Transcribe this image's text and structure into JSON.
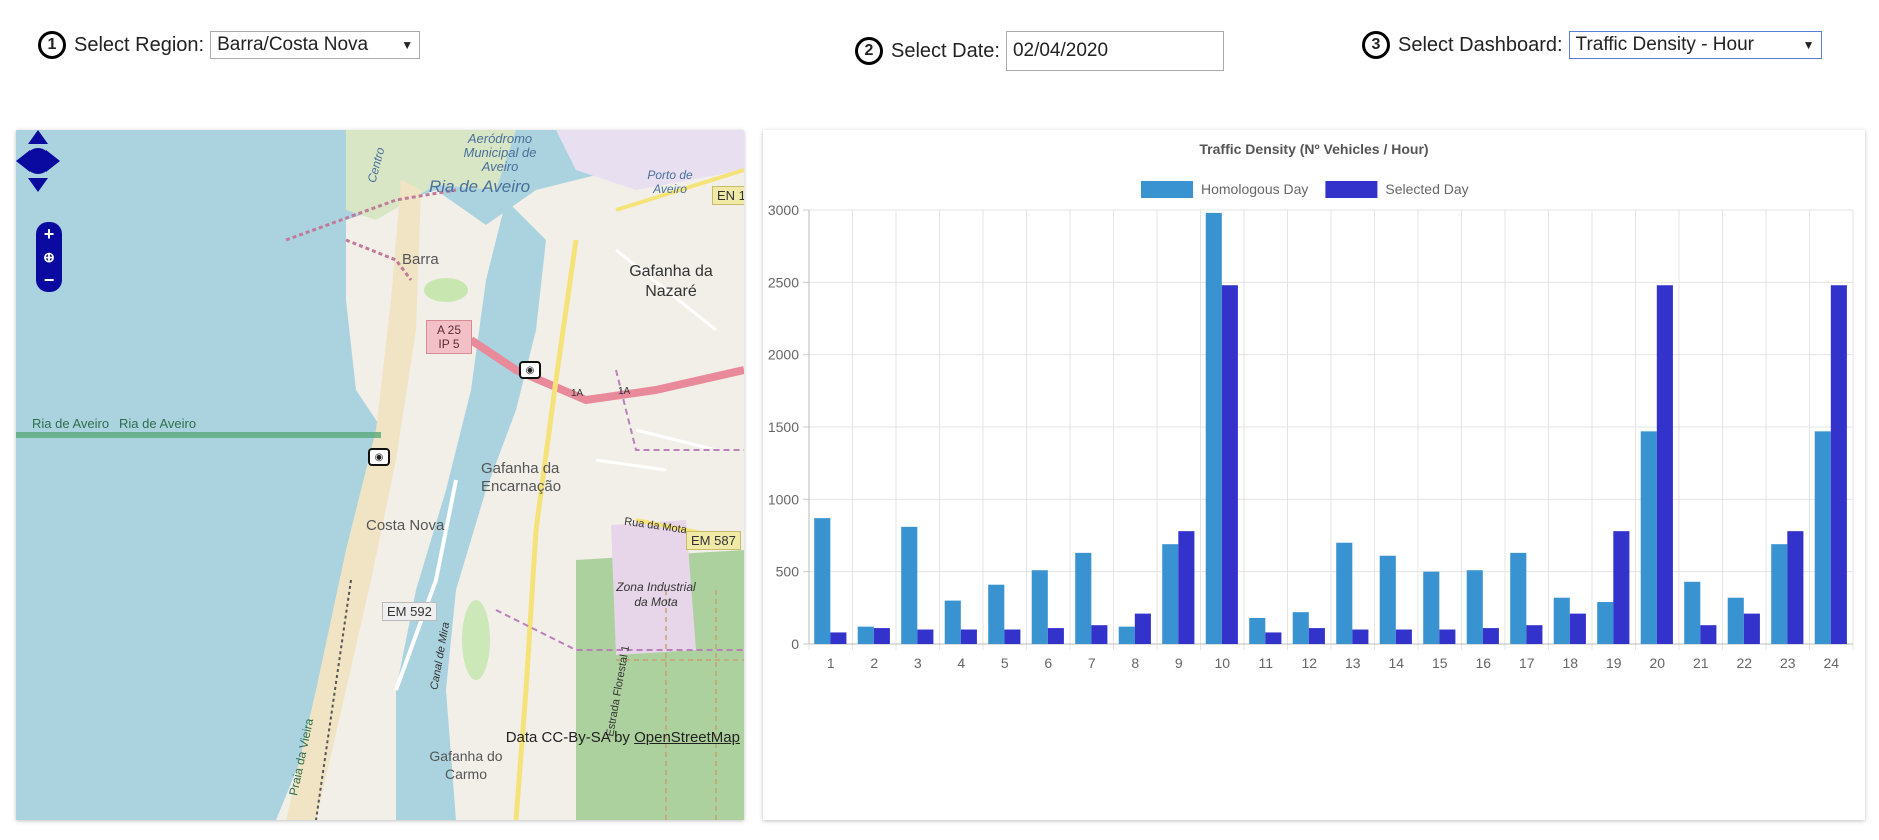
{
  "controls": {
    "step1": {
      "number": "1",
      "label": "Select Region:",
      "value": "Barra/Costa Nova"
    },
    "step2": {
      "number": "2",
      "label": "Select Date:",
      "value": "02/04/2020"
    },
    "step3": {
      "number": "3",
      "label": "Select Dashboard:",
      "value": "Traffic Density - Hour"
    }
  },
  "map": {
    "labels": {
      "aerodromo": "Aeródromo Municipal de Aveiro",
      "ria_top": "Ria de Aveiro",
      "porto": "Porto de Aveiro",
      "centro": "Centro",
      "barra": "Barra",
      "gafanha_nazare": "Gafanha da Nazaré",
      "ria_left1": "Ria de Aveiro",
      "ria_left2": "Ria de Aveiro",
      "gafanha_encarnacao": "Gafanha da Encarnação",
      "costa_nova": "Costa Nova",
      "rua_mota": "Rua da Mota",
      "zona_industrial": "Zona Industrial da Mota",
      "gafanha_carmo": "Gafanha do Carmo",
      "canal_mira": "Canal de Mira",
      "estrada_florestal": "Estrada Florestal 1",
      "praia_vieira": "Praia da Vieira",
      "a1a_1": "1A",
      "a1a_2": "1A"
    },
    "shields": {
      "en": "EN 1",
      "em587": "EM 587",
      "em592": "EM 592",
      "a25_line1": "A 25",
      "a25_line2": "IP 5"
    },
    "attribution_prefix": "Data CC-By-SA by",
    "attribution_link": "OpenStreetMap",
    "zoom_in": "+",
    "zoom_out": "−"
  },
  "chart_data": {
    "type": "bar",
    "title": "Traffic Density (Nº Vehicles / Hour)",
    "xlabel": "",
    "ylabel": "",
    "ylim": [
      0,
      3000
    ],
    "yticks": [
      0,
      500,
      1000,
      1500,
      2000,
      2500,
      3000
    ],
    "categories": [
      "1",
      "2",
      "3",
      "4",
      "5",
      "6",
      "7",
      "8",
      "9",
      "10",
      "11",
      "12",
      "13",
      "14",
      "15",
      "16",
      "17",
      "18",
      "19",
      "20",
      "21",
      "22",
      "23",
      "24"
    ],
    "series": [
      {
        "name": "Homologous Day",
        "color": "#3a93d1",
        "values": [
          870,
          120,
          810,
          300,
          410,
          510,
          630,
          120,
          690,
          2980,
          180,
          220,
          700,
          610,
          500,
          510,
          630,
          320,
          290,
          1470,
          430,
          320,
          690,
          1470
        ]
      },
      {
        "name": "Selected Day",
        "color": "#3333cc",
        "values": [
          80,
          110,
          100,
          100,
          100,
          110,
          130,
          210,
          780,
          2480,
          80,
          110,
          100,
          100,
          100,
          110,
          130,
          210,
          780,
          2480,
          130,
          210,
          780,
          2480
        ]
      }
    ],
    "legend_position": "top",
    "grid": true
  }
}
